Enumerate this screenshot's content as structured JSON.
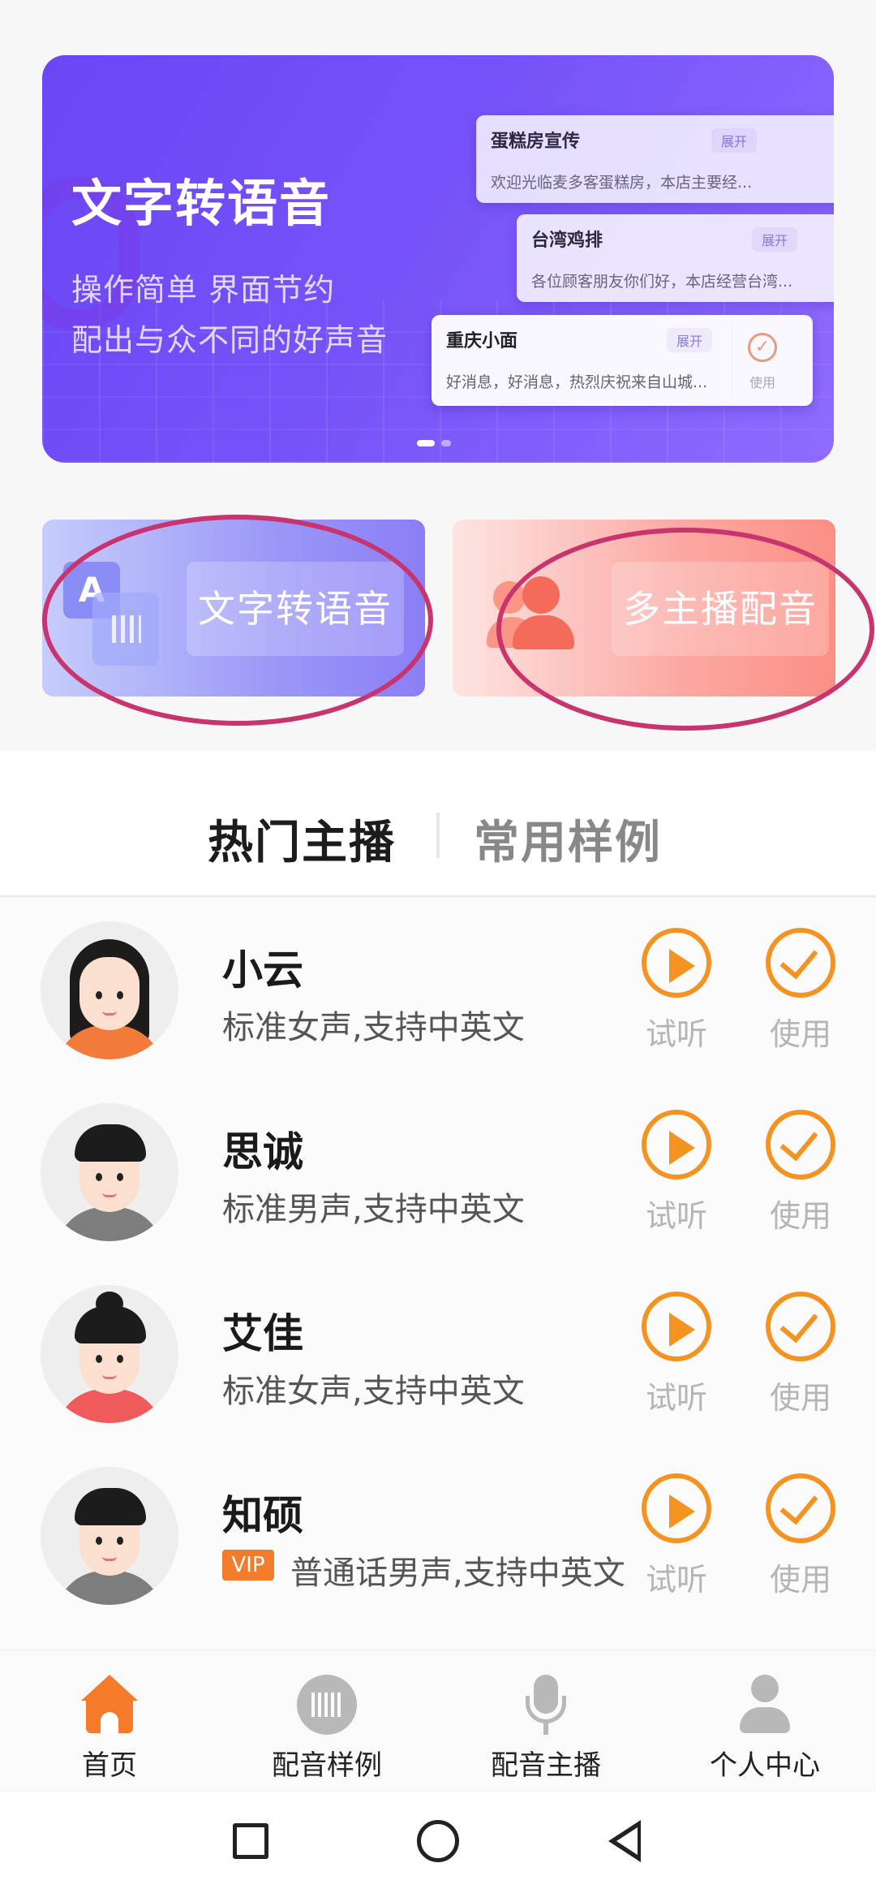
{
  "banner": {
    "title": "文字转语音",
    "subtitle_line1": "操作简单 界面节约",
    "subtitle_line2": "配出与众不同的好声音",
    "cards": [
      {
        "title": "蛋糕房宣传",
        "text": "欢迎光临麦多客蛋糕房，本店主要经...",
        "expand": "展开"
      },
      {
        "title": "台湾鸡排",
        "text": "各位顾客朋友你们好，本店经营台湾...",
        "expand": "展开"
      },
      {
        "title": "重庆小面",
        "text": "好消息，好消息，热烈庆祝来自山城...",
        "expand": "展开",
        "use": "使用"
      }
    ]
  },
  "features": {
    "tts_label": "文字转语音",
    "multi_label": "多主播配音"
  },
  "tabs": {
    "active": "热门主播",
    "inactive": "常用样例"
  },
  "anchors": [
    {
      "name": "小云",
      "desc": "标准女声,支持中英文",
      "vip": false,
      "try": "试听",
      "use": "使用"
    },
    {
      "name": "思诚",
      "desc": "标准男声,支持中英文",
      "vip": false,
      "try": "试听",
      "use": "使用"
    },
    {
      "name": "艾佳",
      "desc": "标准女声,支持中英文",
      "vip": false,
      "try": "试听",
      "use": "使用"
    },
    {
      "name": "知硕",
      "desc": "普通话男声,支持中英文",
      "vip": true,
      "vip_label": "VIP",
      "try": "试听",
      "use": "使用"
    }
  ],
  "bottom_nav": {
    "home": "首页",
    "samples": "配音样例",
    "anchors": "配音主播",
    "profile": "个人中心"
  },
  "colors": {
    "accent": "#f49322",
    "home_active": "#f57b2a",
    "banner": "#7552f8",
    "annotation_ellipse": "#c8346e"
  }
}
